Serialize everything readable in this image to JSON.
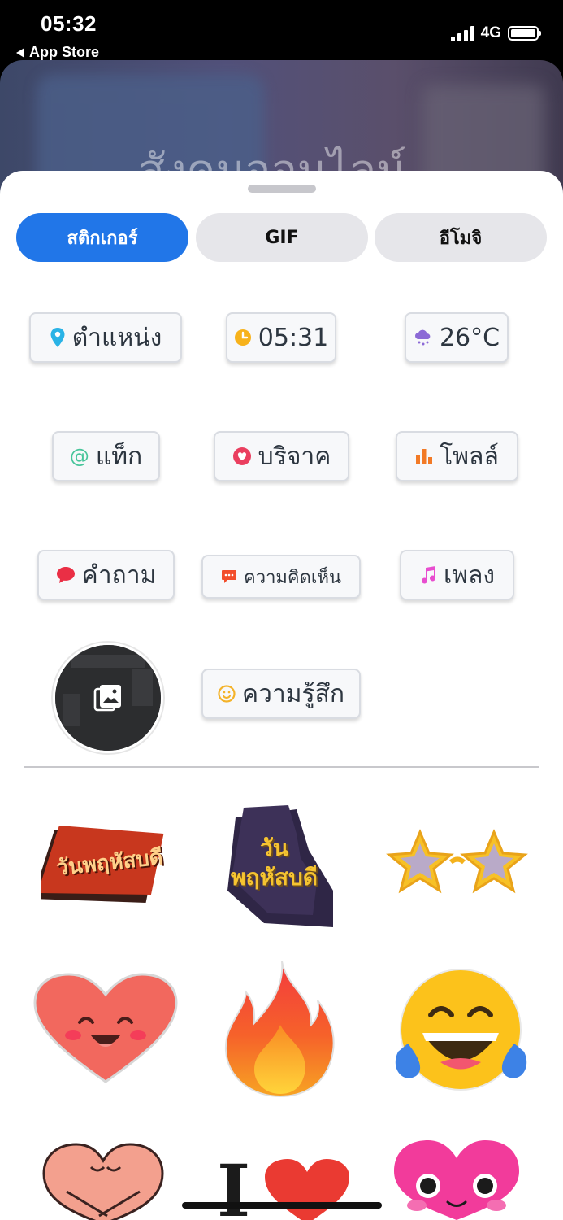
{
  "status_bar": {
    "time": "05:32",
    "back_label": "App Store",
    "network": "4G"
  },
  "background": {
    "title_text": "สังคมออนไลน์"
  },
  "tabs": [
    {
      "label": "สติกเกอร์",
      "active": true
    },
    {
      "label": "GIF",
      "active": false
    },
    {
      "label": "อีโมจิ",
      "active": false
    }
  ],
  "chips": {
    "location": "ตำแหน่ง",
    "time": "05:31",
    "weather": "26°C",
    "tag": "แท็ก",
    "donate": "บริจาค",
    "poll": "โพลล์",
    "question": "คำถาม",
    "comment": "ความคิดเห็น",
    "music": "เพลง",
    "feeling": "ความรู้สึก"
  },
  "stickers": {
    "thursday_1": "วันพฤหัสบดี",
    "thursday_2": "วันพฤหัสบดี",
    "i_text": "I"
  },
  "colors": {
    "accent": "#2176e8",
    "chip_border": "#d9dce2"
  }
}
